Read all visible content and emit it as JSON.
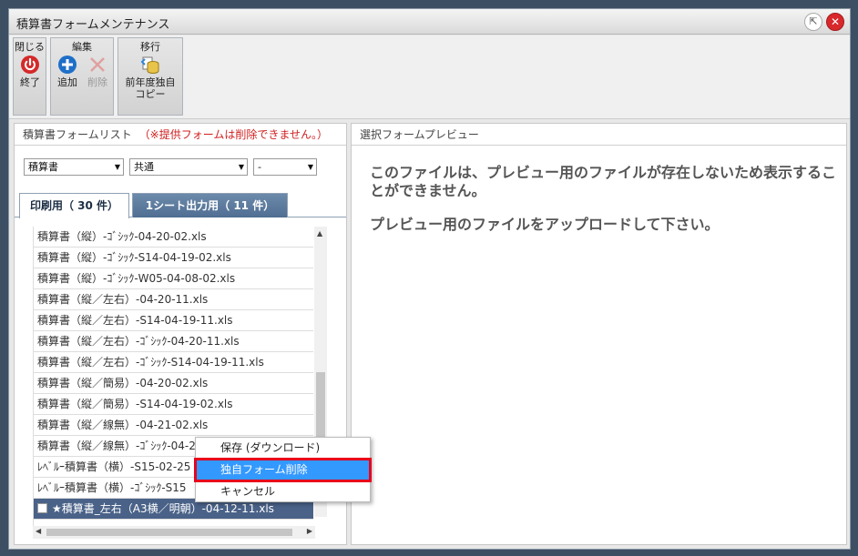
{
  "window": {
    "title": "積算書フォームメンテナンス"
  },
  "toolbar": {
    "groups": [
      {
        "label": "閉じる",
        "tools": [
          {
            "label": "終了",
            "icon": "power-icon"
          }
        ]
      },
      {
        "label": "編集",
        "tools": [
          {
            "label": "追加",
            "icon": "plus-icon"
          },
          {
            "label": "削除",
            "icon": "delete-x-icon",
            "disabled": true
          }
        ]
      },
      {
        "label": "移行",
        "tools": [
          {
            "label": "前年度独自\nコピー",
            "icon": "copy-db-icon"
          }
        ]
      }
    ]
  },
  "left": {
    "header": "積算書フォームリスト",
    "warning": "（※提供フォームは削除できません。）",
    "filters": [
      "積算書",
      "共通",
      "-"
    ],
    "tabs": [
      "印刷用（ 30 件）",
      "1シート出力用（ 11 件）"
    ],
    "rows": [
      "積算書（縦）-ｺﾞｼｯｸ-04-20-02.xls",
      "積算書（縦）-ｺﾞｼｯｸ-S14-04-19-02.xls",
      "積算書（縦）-ｺﾞｼｯｸ-W05-04-08-02.xls",
      "積算書（縦／左右）-04-20-11.xls",
      "積算書（縦／左右）-S14-04-19-11.xls",
      "積算書（縦／左右）-ｺﾞｼｯｸ-04-20-11.xls",
      "積算書（縦／左右）-ｺﾞｼｯｸ-S14-04-19-11.xls",
      "積算書（縦／簡易）-04-20-02.xls",
      "積算書（縦／簡易）-S14-04-19-02.xls",
      "積算書（縦／線無）-04-21-02.xls",
      "積算書（縦／線無）-ｺﾞｼｯｸ-04-2",
      "ﾚﾍﾞﾙｰ積算書（横）-S15-02-25",
      "ﾚﾍﾞﾙｰ積算書（横）-ｺﾞｼｯｸ-S15"
    ],
    "selected_row": "★積算書_左右（A3横／明朝）-04-12-11.xls"
  },
  "right": {
    "header": "選択フォームプレビュー",
    "message1": "このファイルは、プレビュー用のファイルが存在しないため表示することができません。",
    "message2": "プレビュー用のファイルをアップロードして下さい。"
  },
  "context_menu": [
    "保存 (ダウンロード)",
    "独自フォーム削除",
    "キャンセル"
  ]
}
